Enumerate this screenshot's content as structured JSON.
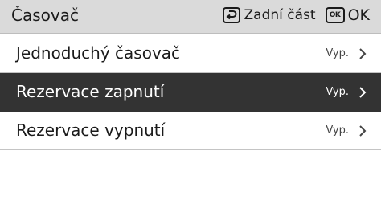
{
  "header": {
    "title": "Časovač",
    "back_label": "Zadní část",
    "ok_key_text": "OK",
    "ok_label": "OK",
    "back_icon": "back-arrow-icon"
  },
  "menu": {
    "items": [
      {
        "label": "Jednoduchý časovač",
        "value": "Vyp.",
        "selected": false
      },
      {
        "label": "Rezervace zapnutí",
        "value": "Vyp.",
        "selected": true
      },
      {
        "label": "Rezervace vypnutí",
        "value": "Vyp.",
        "selected": false
      }
    ]
  },
  "colors": {
    "header_bg": "#dadada",
    "selected_bg": "#333333",
    "text": "#1a1a1a"
  }
}
